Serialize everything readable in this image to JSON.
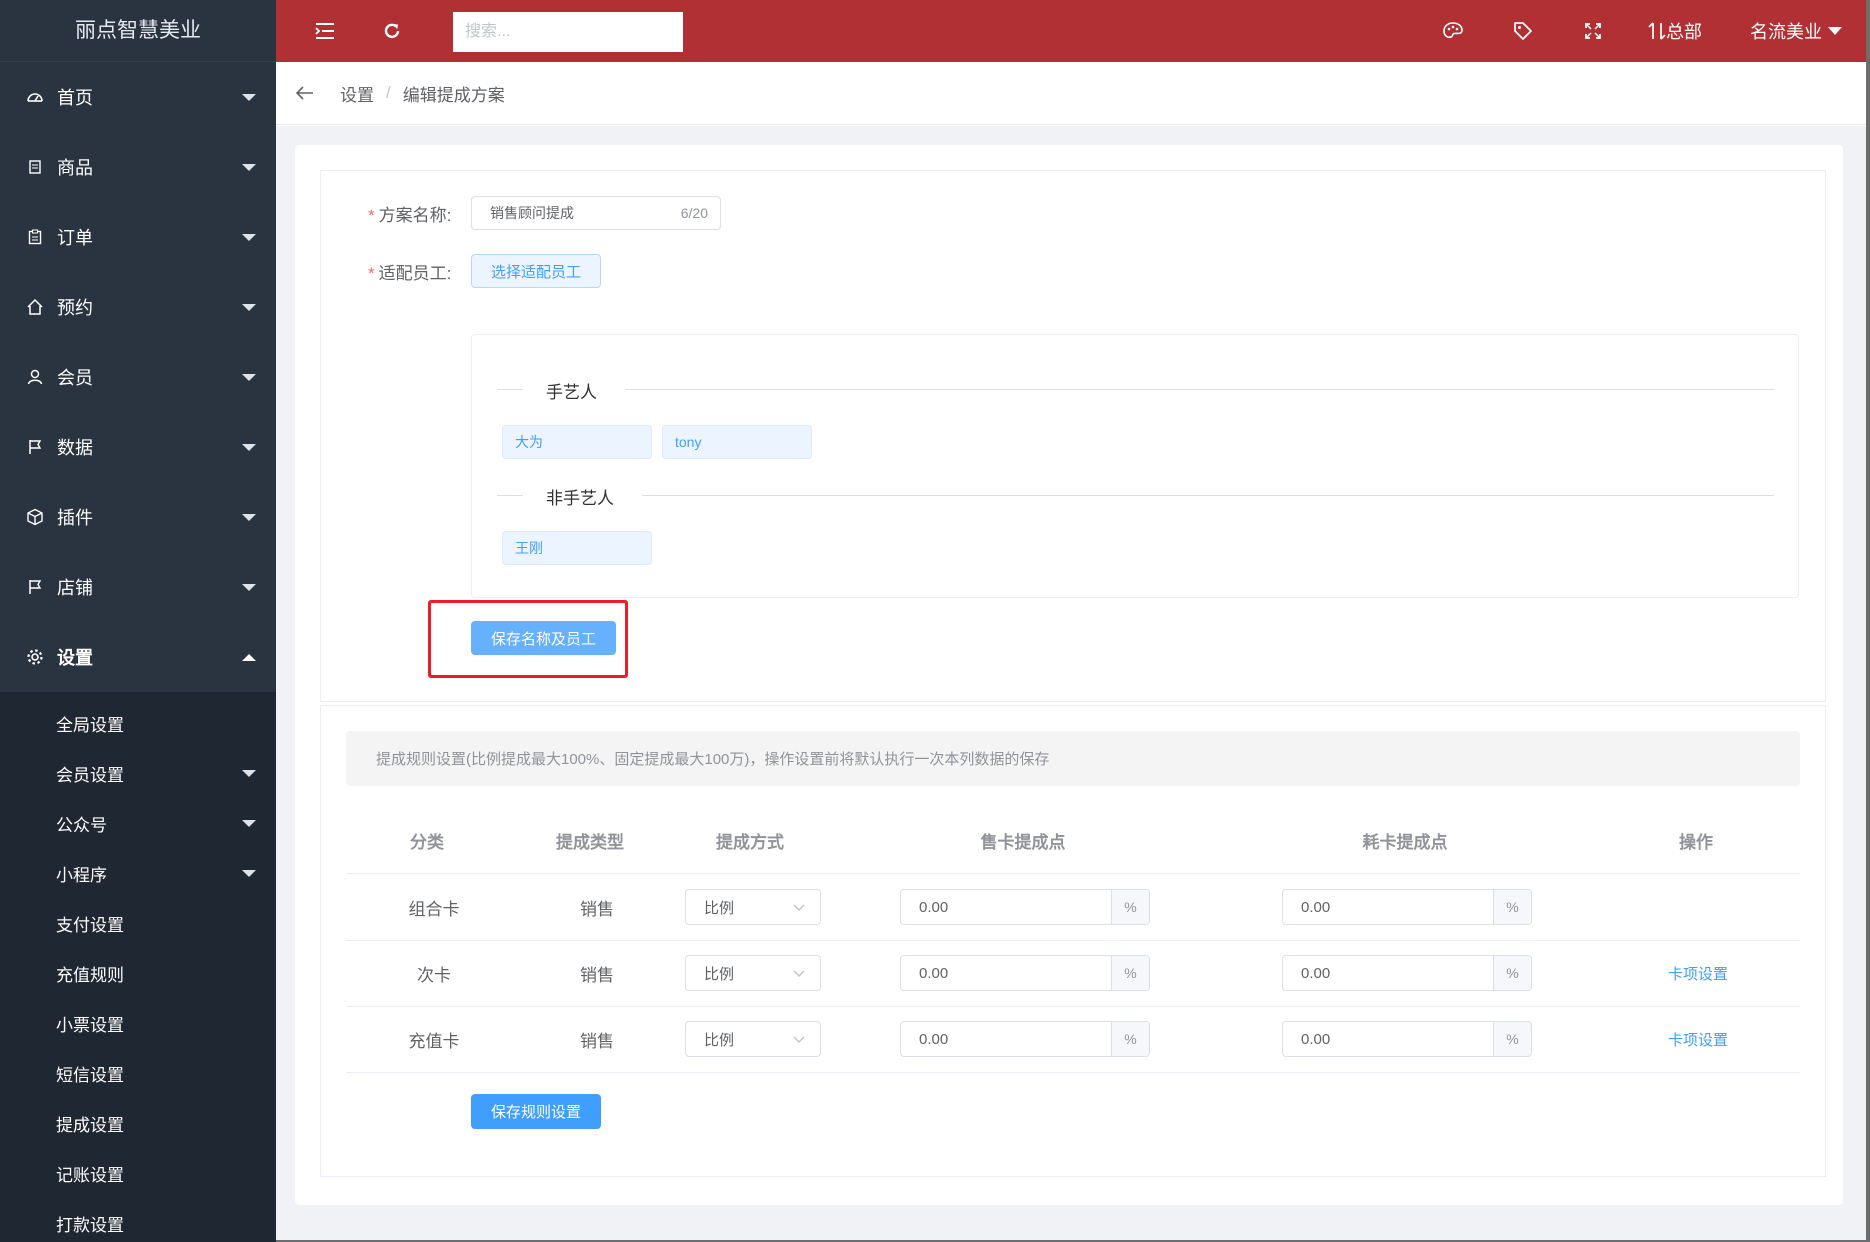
{
  "app": {
    "logo": "丽点智慧美业"
  },
  "topbar": {
    "search_placeholder": "搜索...",
    "branch_label": "总部",
    "store_name": "名流美业",
    "icons": [
      "menu-fold-icon",
      "refresh-icon",
      "palette-icon",
      "tag-icon",
      "fullscreen-icon",
      "switch-icon"
    ]
  },
  "sidebar": {
    "items": [
      {
        "label": "首页",
        "icon": "dashboard-icon"
      },
      {
        "label": "商品",
        "icon": "document-icon"
      },
      {
        "label": "订单",
        "icon": "clipboard-icon"
      },
      {
        "label": "预约",
        "icon": "home-icon"
      },
      {
        "label": "会员",
        "icon": "user-icon"
      },
      {
        "label": "数据",
        "icon": "flag-icon"
      },
      {
        "label": "插件",
        "icon": "box-icon"
      },
      {
        "label": "店铺",
        "icon": "flag-icon"
      },
      {
        "label": "设置",
        "icon": "gear-icon"
      }
    ],
    "sub_items": [
      {
        "label": "全局设置",
        "has_caret": false
      },
      {
        "label": "会员设置",
        "has_caret": true
      },
      {
        "label": "公众号",
        "has_caret": true
      },
      {
        "label": "小程序",
        "has_caret": true
      },
      {
        "label": "支付设置",
        "has_caret": false
      },
      {
        "label": "充值规则",
        "has_caret": false
      },
      {
        "label": "小票设置",
        "has_caret": false
      },
      {
        "label": "短信设置",
        "has_caret": false
      },
      {
        "label": "提成设置",
        "has_caret": false
      },
      {
        "label": "记账设置",
        "has_caret": false
      },
      {
        "label": "打款设置",
        "has_caret": false
      }
    ]
  },
  "breadcrumb": {
    "items": [
      "设置",
      "编辑提成方案"
    ],
    "separator": "/"
  },
  "form": {
    "name_label": "方案名称:",
    "name_value": "销售顾问提成",
    "name_count": "6/20",
    "staff_label": "适配员工:",
    "select_staff_button": "选择适配员工",
    "groups": [
      {
        "title": "手艺人",
        "members": [
          "大为",
          "tony"
        ]
      },
      {
        "title": "非手艺人",
        "members": [
          "王刚"
        ]
      }
    ],
    "save_button": "保存名称及员工"
  },
  "rules": {
    "notice": "提成规则设置(比例提成最大100%、固定提成最大100万)，操作设置前将默认执行一次本列数据的保存",
    "columns": [
      "分类",
      "提成类型",
      "提成方式",
      "售卡提成点",
      "耗卡提成点",
      "操作"
    ],
    "rows": [
      {
        "category": "组合卡",
        "type": "销售",
        "method": "比例",
        "sell_point": "0.00",
        "consume_point": "0.00",
        "unit": "%",
        "action": ""
      },
      {
        "category": "次卡",
        "type": "销售",
        "method": "比例",
        "sell_point": "0.00",
        "consume_point": "0.00",
        "unit": "%",
        "action": "卡项设置"
      },
      {
        "category": "充值卡",
        "type": "销售",
        "method": "比例",
        "sell_point": "0.00",
        "consume_point": "0.00",
        "unit": "%",
        "action": "卡项设置"
      }
    ],
    "save_button": "保存规则设置"
  },
  "colors": {
    "topbar": "#b03034",
    "sidebar": "#2a3441",
    "primary": "#409eff",
    "highlight_box": "#ee1c25"
  }
}
